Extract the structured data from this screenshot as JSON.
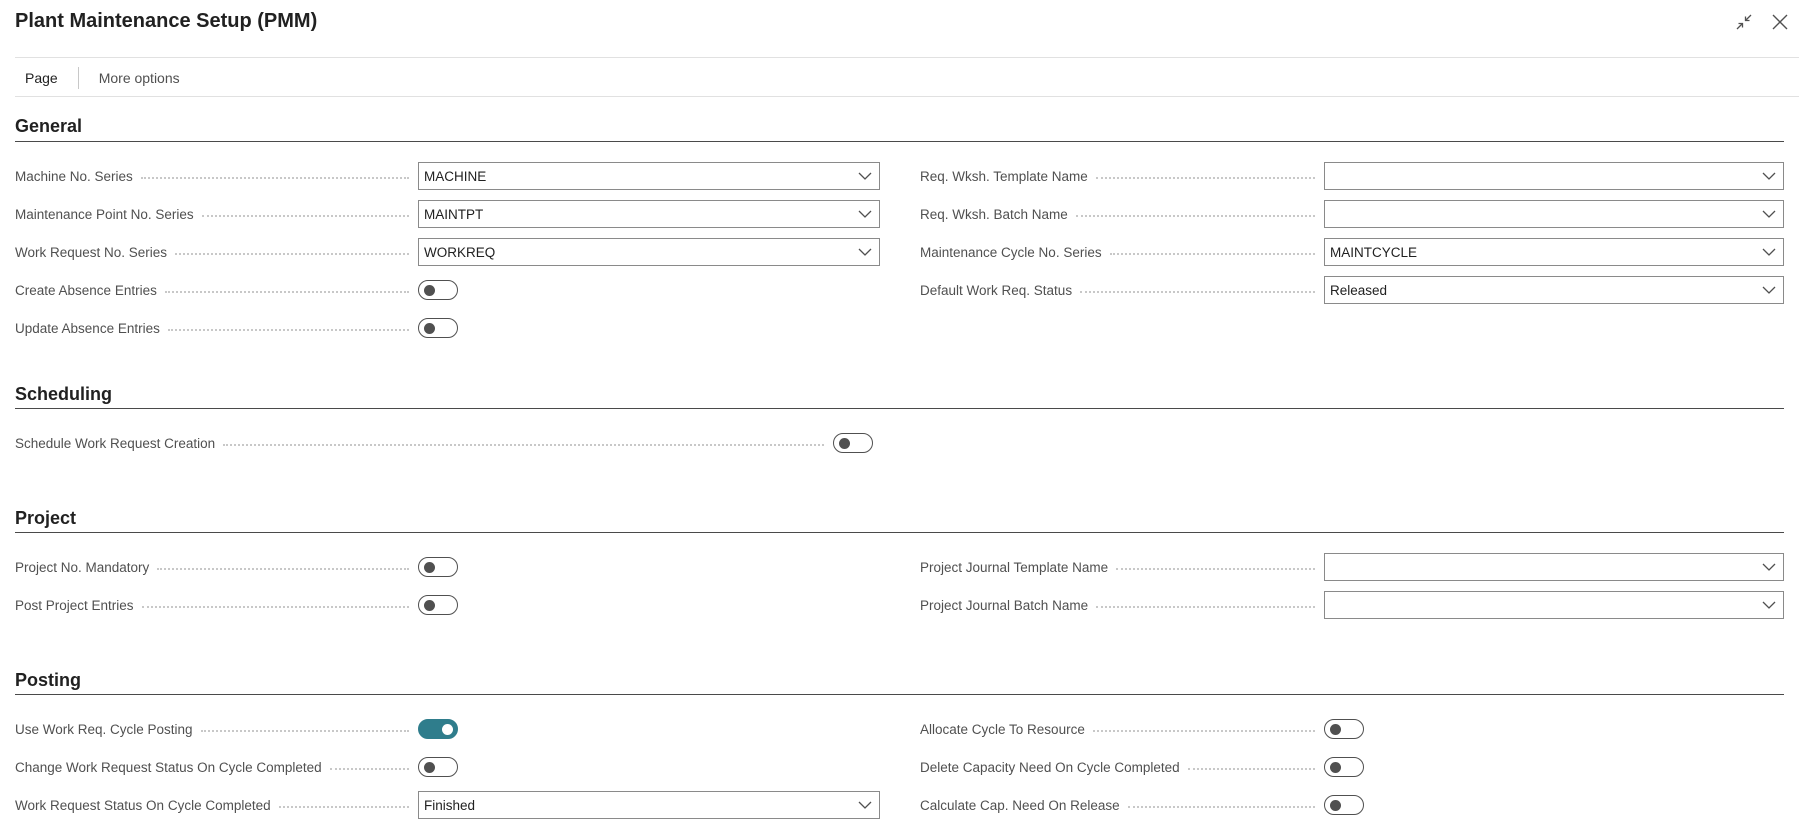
{
  "window": {
    "title": "Plant Maintenance Setup (PMM)"
  },
  "toolbar": {
    "page_label": "Page",
    "more_options_label": "More options"
  },
  "sections": {
    "general": {
      "title": "General",
      "machine_no_series": {
        "label": "Machine No. Series",
        "value": "MACHINE"
      },
      "maintenance_point_no_series": {
        "label": "Maintenance Point No. Series",
        "value": "MAINTPT"
      },
      "work_request_no_series": {
        "label": "Work Request No. Series",
        "value": "WORKREQ"
      },
      "create_absence_entries": {
        "label": "Create Absence Entries",
        "value": false
      },
      "update_absence_entries": {
        "label": "Update Absence Entries",
        "value": false
      },
      "req_wksh_template_name": {
        "label": "Req. Wksh. Template Name",
        "value": ""
      },
      "req_wksh_batch_name": {
        "label": "Req. Wksh. Batch Name",
        "value": ""
      },
      "maintenance_cycle_no_series": {
        "label": "Maintenance Cycle No. Series",
        "value": "MAINTCYCLE"
      },
      "default_work_req_status": {
        "label": "Default Work Req. Status",
        "value": "Released"
      }
    },
    "scheduling": {
      "title": "Scheduling",
      "schedule_work_request_creation": {
        "label": "Schedule Work Request Creation",
        "value": false
      }
    },
    "project": {
      "title": "Project",
      "project_no_mandatory": {
        "label": "Project No. Mandatory",
        "value": false
      },
      "post_project_entries": {
        "label": "Post Project Entries",
        "value": false
      },
      "project_journal_template_name": {
        "label": "Project Journal Template Name",
        "value": ""
      },
      "project_journal_batch_name": {
        "label": "Project Journal Batch Name",
        "value": ""
      }
    },
    "posting": {
      "title": "Posting",
      "use_work_req_cycle_posting": {
        "label": "Use Work Req. Cycle Posting",
        "value": true
      },
      "change_work_request_status_on_cycle_completed": {
        "label": "Change Work Request Status On Cycle Completed",
        "value": false
      },
      "work_request_status_on_cycle_completed": {
        "label": "Work Request Status On Cycle Completed",
        "value": "Finished"
      },
      "allocate_cycle_to_resource": {
        "label": "Allocate Cycle To Resource",
        "value": false
      },
      "delete_capacity_need_on_cycle_completed": {
        "label": "Delete Capacity Need On Cycle Completed",
        "value": false
      },
      "calculate_cap_need_on_release": {
        "label": "Calculate Cap. Need On Release",
        "value": false
      }
    }
  },
  "colors": {
    "accent": "#2f7d8c",
    "text": "#212121",
    "label": "#505050",
    "field_border": "#8a8a8a"
  }
}
